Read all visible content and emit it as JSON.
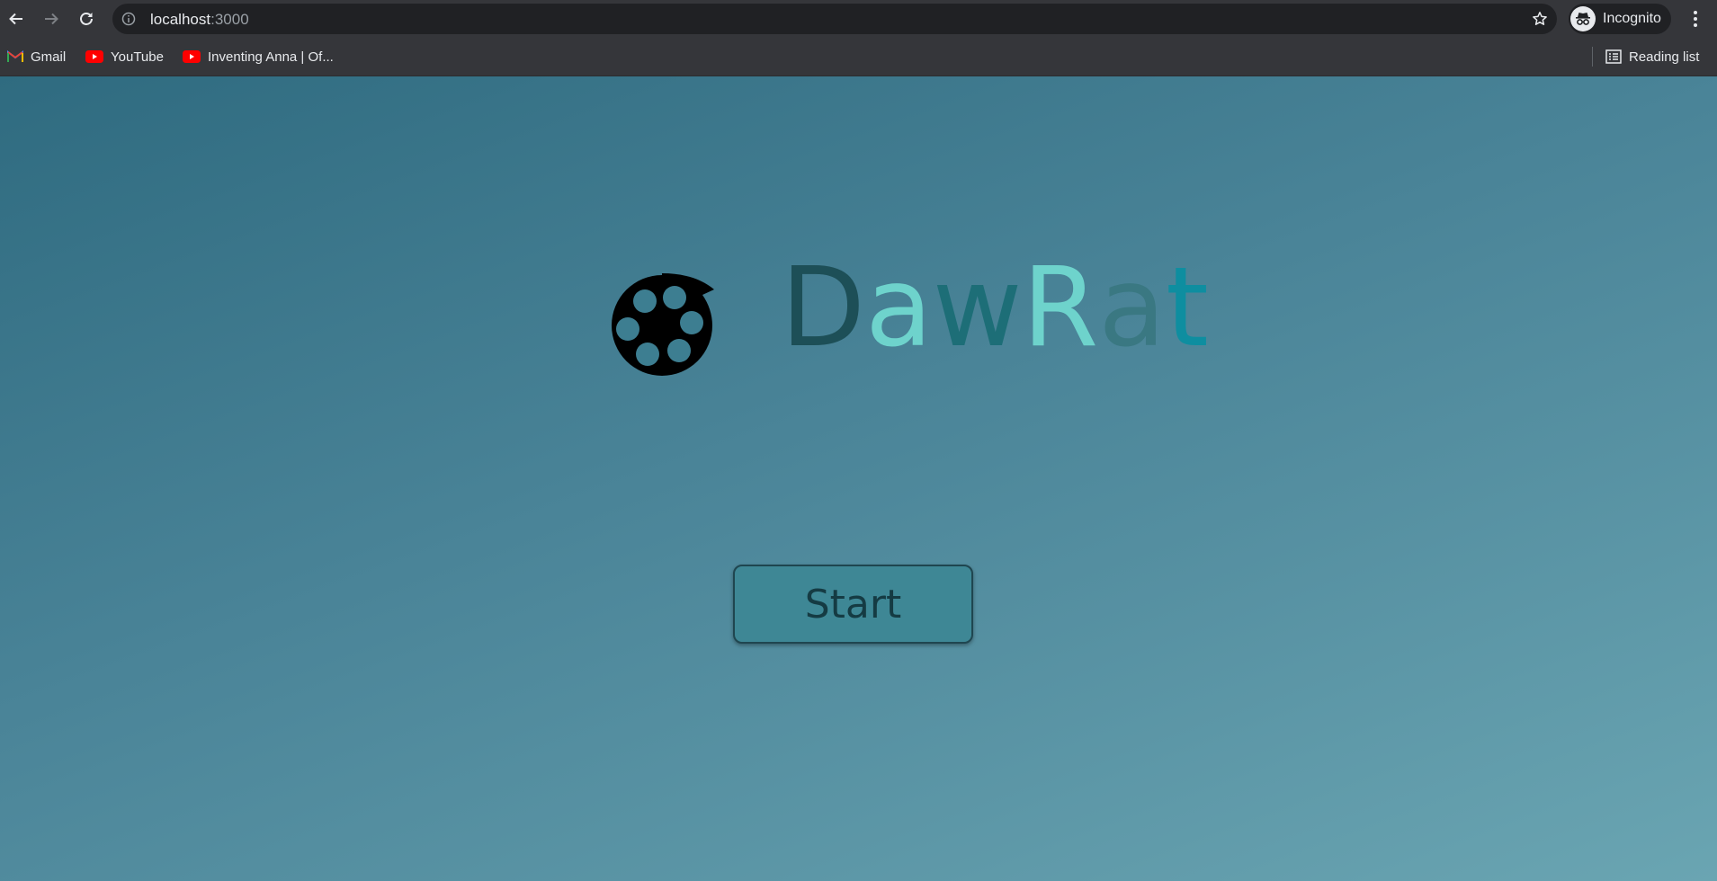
{
  "browser": {
    "url_host": "localhost",
    "url_port": ":3000",
    "profile_label": "Incognito"
  },
  "bookmarks": [
    {
      "label": "Gmail",
      "icon": "gmail-icon"
    },
    {
      "label": "YouTube",
      "icon": "youtube-icon"
    },
    {
      "label": "Inventing Anna | Of...",
      "icon": "youtube-icon"
    }
  ],
  "reading_list_label": "Reading list",
  "page": {
    "brand_letters": [
      {
        "char": "D",
        "color": "#1d4f57"
      },
      {
        "char": "a",
        "color": "#6ed3cc"
      },
      {
        "char": "w",
        "color": "#1d6e77"
      },
      {
        "char": "R",
        "color": "#6ed3cc"
      },
      {
        "char": "a",
        "color": "#3a7882"
      },
      {
        "char": "t",
        "color": "#0e8ea0"
      }
    ],
    "start_label": "Start"
  },
  "colors": {
    "toolbar": "#35363a",
    "omnibox": "#202124",
    "page_gradient_start": "#2f6b80",
    "page_gradient_end": "#6aa5b2",
    "start_button": "#3e8795"
  }
}
